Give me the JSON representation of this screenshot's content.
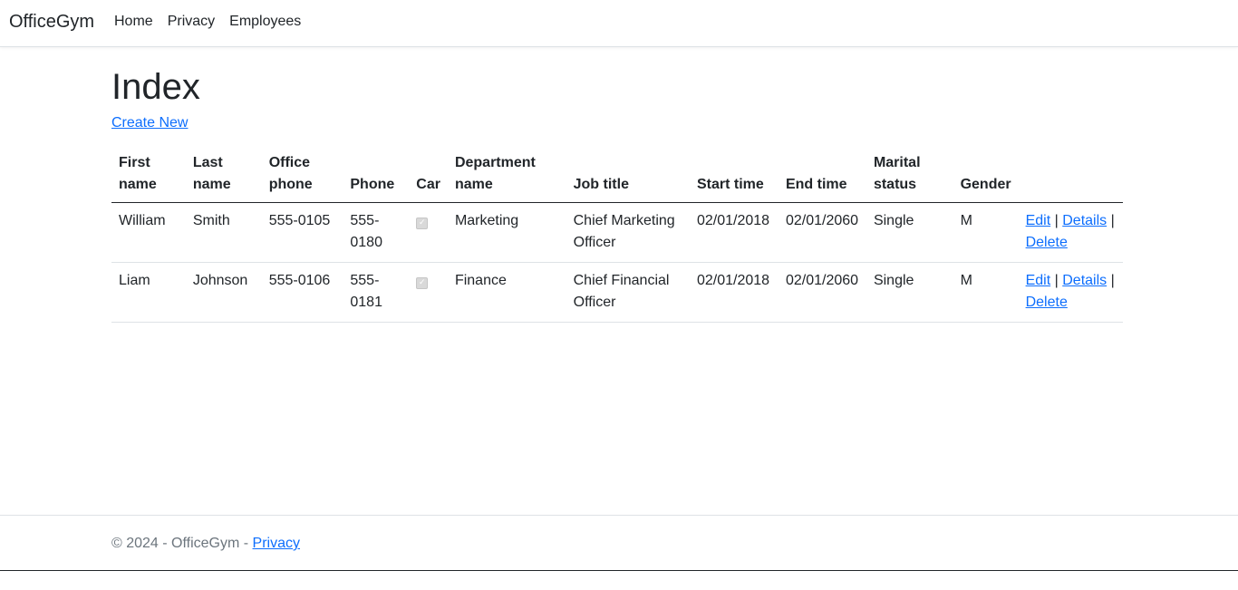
{
  "navbar": {
    "brand": "OfficeGym",
    "links": [
      "Home",
      "Privacy",
      "Employees"
    ]
  },
  "page": {
    "title": "Index",
    "create_new": "Create New"
  },
  "table": {
    "headers": [
      "First name",
      "Last name",
      "Office phone",
      "Phone",
      "Car",
      "Department name",
      "Job title",
      "Start time",
      "End time",
      "Marital status",
      "Gender"
    ],
    "rows": [
      {
        "first_name": "William",
        "last_name": "Smith",
        "office_phone": "555-0105",
        "phone": "555-0180",
        "car": true,
        "department": "Marketing",
        "job_title": "Chief Marketing Officer",
        "start_time": "02/01/2018",
        "end_time": "02/01/2060",
        "marital_status": "Single",
        "gender": "M"
      },
      {
        "first_name": "Liam",
        "last_name": "Johnson",
        "office_phone": "555-0106",
        "phone": "555-0181",
        "car": true,
        "department": "Finance",
        "job_title": "Chief Financial Officer",
        "start_time": "02/01/2018",
        "end_time": "02/01/2060",
        "marital_status": "Single",
        "gender": "M"
      }
    ],
    "actions": {
      "edit": "Edit",
      "details": "Details",
      "delete": "Delete",
      "separator": "|"
    }
  },
  "footer": {
    "text": "© 2024 - OfficeGym - ",
    "privacy": "Privacy"
  },
  "colors": {
    "link": "#0d6efd",
    "muted": "#6c757d",
    "text": "#212529"
  }
}
